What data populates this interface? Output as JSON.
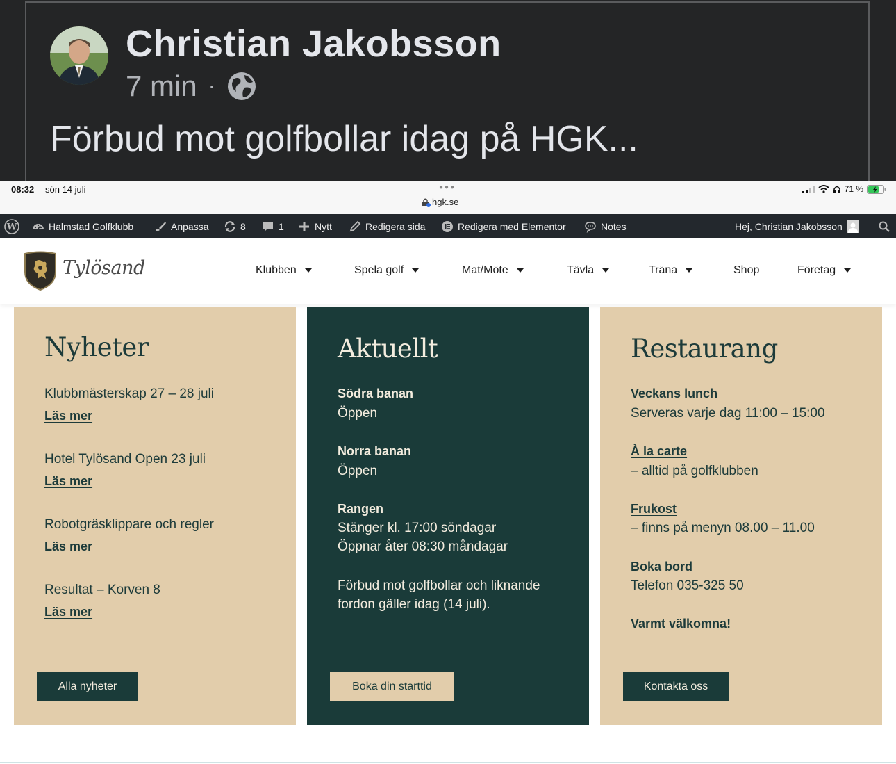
{
  "post": {
    "author": "Christian Jakobsson",
    "time": "7 min",
    "separator": "·",
    "text": "Förbud mot golfbollar idag på HGK..."
  },
  "statusbar": {
    "time": "08:32",
    "date": "sön 14 juli",
    "url": "hgk.se",
    "battery": "71 %"
  },
  "adminbar": {
    "site": "Halmstad Golfklubb",
    "customize": "Anpassa",
    "updates": "8",
    "comments": "1",
    "new": "Nytt",
    "edit_page": "Redigera sida",
    "edit_elementor": "Redigera med Elementor",
    "notes": "Notes",
    "greeting": "Hej, Christian Jakobsson"
  },
  "header": {
    "logo": "Tylösand",
    "nav": [
      "Klubben",
      "Spela golf",
      "Mat/Möte",
      "Tävla",
      "Träna",
      "Shop",
      "Företag"
    ]
  },
  "nyheter": {
    "title": "Nyheter",
    "items": [
      {
        "title": "Klubbmästerskap 27 – 28 juli",
        "link": "Läs mer"
      },
      {
        "title": "Hotel Tylösand Open 23 juli",
        "link": "Läs mer"
      },
      {
        "title": "Robotgräsklippare och regler",
        "link": "Läs mer"
      },
      {
        "title": "Resultat – Korven 8",
        "link": "Läs mer"
      }
    ],
    "button": "Alla nyheter"
  },
  "aktuellt": {
    "title": "Aktuellt",
    "items": [
      {
        "heading": "Södra banan",
        "lines": [
          "Öppen"
        ]
      },
      {
        "heading": "Norra banan",
        "lines": [
          "Öppen"
        ]
      },
      {
        "heading": "Rangen",
        "lines": [
          "Stänger kl. 17:00 söndagar",
          "Öppnar åter 08:30 måndagar"
        ]
      }
    ],
    "notice": [
      "Förbud mot golfbollar och liknande",
      "fordon gäller idag (14 juli)."
    ],
    "button": "Boka din starttid"
  },
  "restaurang": {
    "title": "Restaurang",
    "items": [
      {
        "heading": "Veckans lunch",
        "text": "Serveras varje dag 11:00 – 15:00"
      },
      {
        "heading": "À la carte",
        "text": "– alltid på golfklubben"
      },
      {
        "heading": "Frukost",
        "text": "– finns på menyn 08.00 – 11.00"
      },
      {
        "heading": "Boka bord",
        "text": "Telefon 035-325 50"
      }
    ],
    "welcome": "Varmt välkomna!",
    "button": "Kontakta oss"
  },
  "colors": {
    "beige": "#e2cdab",
    "dark_green": "#1a3b39",
    "admin_bar": "#23282d",
    "fb_background": "#242526"
  }
}
